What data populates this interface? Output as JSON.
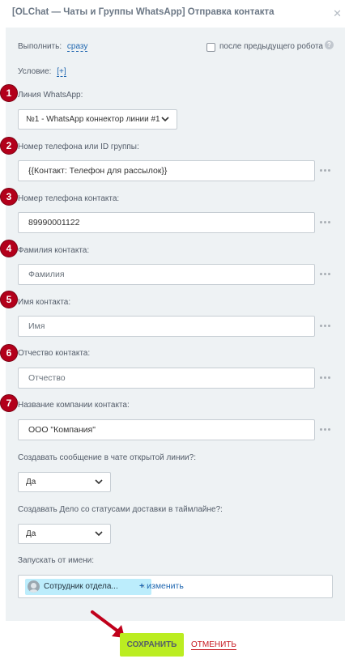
{
  "window": {
    "title": "[OLChat — Чаты и Группы WhatsApp] Отправка контакта",
    "close_icon": "close-icon"
  },
  "form": {
    "execute_label": "Выполнить:",
    "execute_value": "сразу",
    "after_robot_label": "после предыдущего робота",
    "help_glyph": "?",
    "condition_label": "Условие:",
    "condition_value": "[+]",
    "line": {
      "label": "Линия WhatsApp:",
      "value": "№1 - WhatsApp коннектор линии #1"
    },
    "fields": [
      {
        "badge": "1"
      },
      {
        "badge": "2",
        "label": "Номер телефона или ID группы:",
        "value": "{{Контакт: Телефон для рассылок}}",
        "kind": "value"
      },
      {
        "badge": "3",
        "label": "Номер телефона контакта:",
        "value": "89990001122",
        "kind": "value"
      },
      {
        "badge": "4",
        "label": "Фамилия контакта:",
        "value": "Фамилия",
        "kind": "placeholder"
      },
      {
        "badge": "5",
        "label": "Имя контакта:",
        "value": "Имя",
        "kind": "placeholder"
      },
      {
        "badge": "6",
        "label": "Отчество контакта:",
        "value": "Отчество",
        "kind": "placeholder"
      },
      {
        "badge": "7",
        "label": "Название компании контакта:",
        "value": "ООО \"Компания\"",
        "kind": "value"
      }
    ],
    "open_line_message": {
      "label": "Создавать сообщение в чате открытой линии?:",
      "value": "Да"
    },
    "delivery_task": {
      "label": "Создавать Дело со статусами доставки в таймлайне?:",
      "value": "Да"
    },
    "run_as": {
      "label": "Запускать от имени:",
      "user": "Сотрудник отдела...",
      "remove_glyph": "×",
      "change_plus": "+",
      "change_label": "изменить"
    }
  },
  "footer": {
    "save_label": "СОХРАНИТЬ",
    "cancel_label": "ОТМЕНИТЬ"
  },
  "colors": {
    "badge": "#b3001b",
    "panel": "#eef2f4",
    "save": "#bbed21",
    "link": "#2067b0",
    "cancel": "#c6171e"
  }
}
